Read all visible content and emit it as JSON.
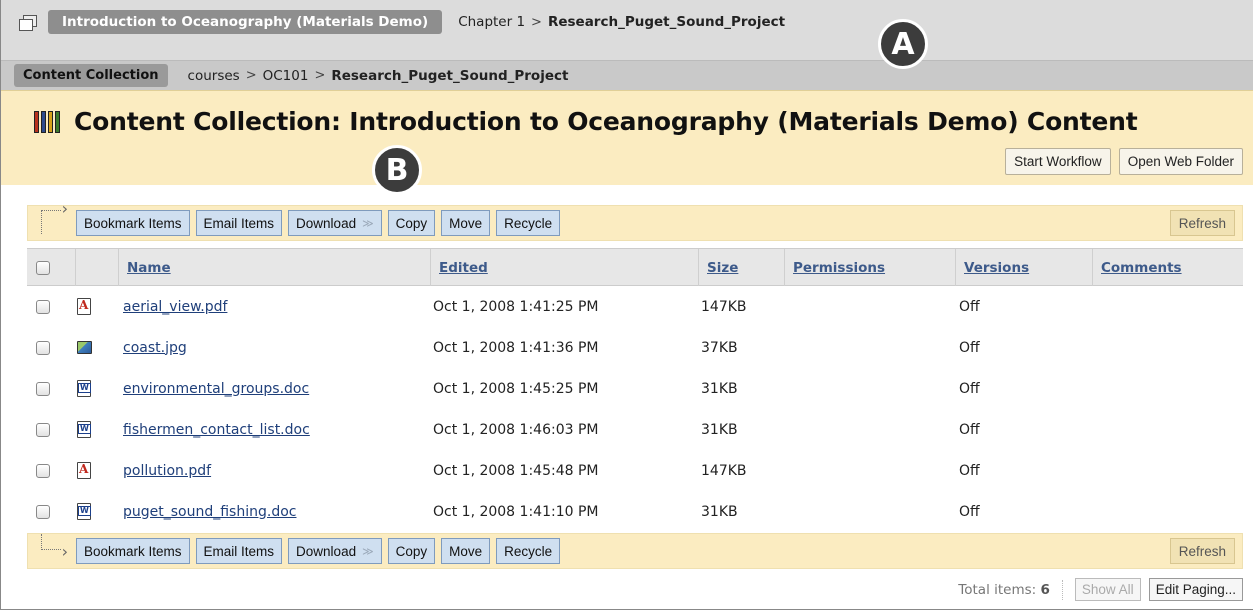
{
  "breadcrumb1": {
    "course": "Introduction to Oceanography (Materials Demo)",
    "chapter": "Chapter 1",
    "separator": ">",
    "current": "Research_Puget_Sound_Project"
  },
  "breadcrumb2": {
    "collection": "Content Collection",
    "path1": "courses",
    "path2": "OC101",
    "separator": ">",
    "current": "Research_Puget_Sound_Project"
  },
  "markers": {
    "a": "A",
    "b": "B"
  },
  "page": {
    "title": "Content Collection: Introduction to Oceanography (Materials Demo) Content",
    "start_workflow": "Start Workflow",
    "open_web_folder": "Open Web Folder"
  },
  "actions": {
    "bookmark": "Bookmark Items",
    "email": "Email Items",
    "download": "Download",
    "copy": "Copy",
    "move": "Move",
    "recycle": "Recycle",
    "refresh": "Refresh"
  },
  "table": {
    "headers": {
      "name": "Name",
      "edited": "Edited",
      "size": "Size",
      "permissions": "Permissions",
      "versions": "Versions",
      "comments": "Comments"
    },
    "rows": [
      {
        "icon": "pdf-icon",
        "type": "pdf",
        "name": "aerial_view.pdf",
        "edited": "Oct 1, 2008 1:41:25 PM",
        "size": "147KB",
        "versions": "Off"
      },
      {
        "icon": "image-icon",
        "type": "jpg",
        "name": "coast.jpg",
        "edited": "Oct 1, 2008 1:41:36 PM",
        "size": "37KB",
        "versions": "Off"
      },
      {
        "icon": "word-doc-icon",
        "type": "doc",
        "name": "environmental_groups.doc",
        "edited": "Oct 1, 2008 1:45:25 PM",
        "size": "31KB",
        "versions": "Off"
      },
      {
        "icon": "word-doc-icon",
        "type": "doc",
        "name": "fishermen_contact_list.doc",
        "edited": "Oct 1, 2008 1:46:03 PM",
        "size": "31KB",
        "versions": "Off"
      },
      {
        "icon": "pdf-icon",
        "type": "pdf",
        "name": "pollution.pdf",
        "edited": "Oct 1, 2008 1:45:48 PM",
        "size": "147KB",
        "versions": "Off"
      },
      {
        "icon": "word-doc-icon",
        "type": "doc",
        "name": "puget_sound_fishing.doc",
        "edited": "Oct 1, 2008 1:41:10 PM",
        "size": "31KB",
        "versions": "Off"
      }
    ]
  },
  "footer": {
    "total_label": "Total items:",
    "total_value": "6",
    "show_all": "Show All",
    "edit_paging": "Edit Paging..."
  }
}
